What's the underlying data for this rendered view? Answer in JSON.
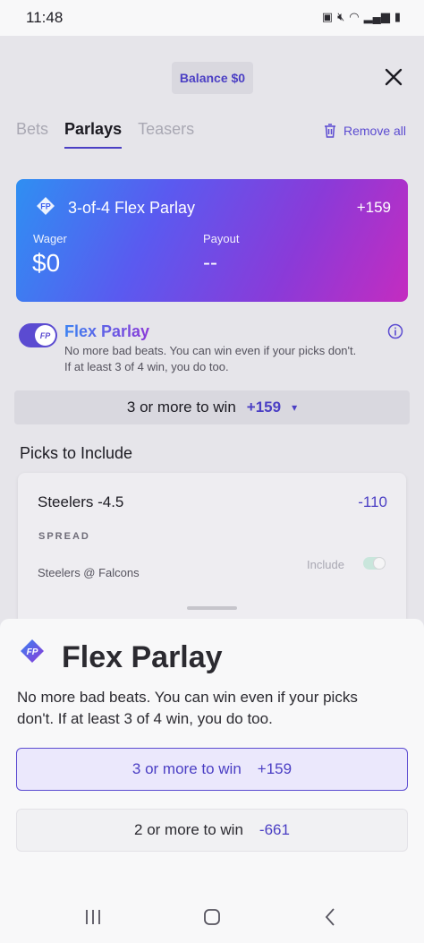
{
  "status": {
    "time": "11:48"
  },
  "header": {
    "balance": "Balance $0"
  },
  "tabs": [
    {
      "label": "Bets"
    },
    {
      "label": "Parlays"
    },
    {
      "label": "Teasers"
    }
  ],
  "remove_all": "Remove all",
  "card": {
    "title": "3-of-4 Flex Parlay",
    "odds": "+159",
    "wager_label": "Wager",
    "wager_value": "$0",
    "payout_label": "Payout",
    "payout_value": "--"
  },
  "flex": {
    "title": "Flex Parlay",
    "description": "No more bad beats. You can win even if your picks don't. If at least 3 of 4 win, you do too."
  },
  "win_selector": {
    "label": "3 or more to win",
    "odds": "+159"
  },
  "picks": {
    "heading": "Picks to Include",
    "items": [
      {
        "team": "Steelers -4.5",
        "odds": "-110",
        "type": "SPREAD",
        "matchup": "Steelers @ Falcons",
        "include_label": "Include"
      }
    ]
  },
  "bottom_sheet": {
    "title": "Flex Parlay",
    "description": "No more bad beats. You can win even if your picks don't. If at least 3 of 4 win, you do too.",
    "options": [
      {
        "label": "3 or more to win",
        "odds": "+159"
      },
      {
        "label": "2 or more to win",
        "odds": "-661"
      }
    ]
  },
  "colors": {
    "accent": "#5b4bd1",
    "card_gradient_start": "#2f8ff2",
    "card_gradient_end": "#c42cc0"
  }
}
